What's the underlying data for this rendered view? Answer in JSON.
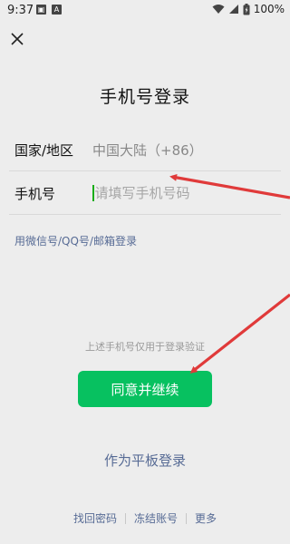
{
  "status_bar": {
    "time": "9:37",
    "battery": "100%"
  },
  "header": {
    "title": "手机号登录"
  },
  "form": {
    "region_label": "国家/地区",
    "region_value": "中国大陆（+86）",
    "phone_label": "手机号",
    "phone_placeholder": "请填写手机号码"
  },
  "links": {
    "alt_login": "用微信号/QQ号/邮箱登录"
  },
  "notice": {
    "text": "上述手机号仅用于登录验证"
  },
  "buttons": {
    "agree_continue": "同意并继续",
    "tablet_login": "作为平板登录"
  },
  "footer": {
    "items": [
      "找回密码",
      "冻结账号",
      "更多"
    ]
  },
  "colors": {
    "primary_green": "#07c160",
    "link_blue": "#576b95",
    "annotation_red": "#e03a3a"
  }
}
